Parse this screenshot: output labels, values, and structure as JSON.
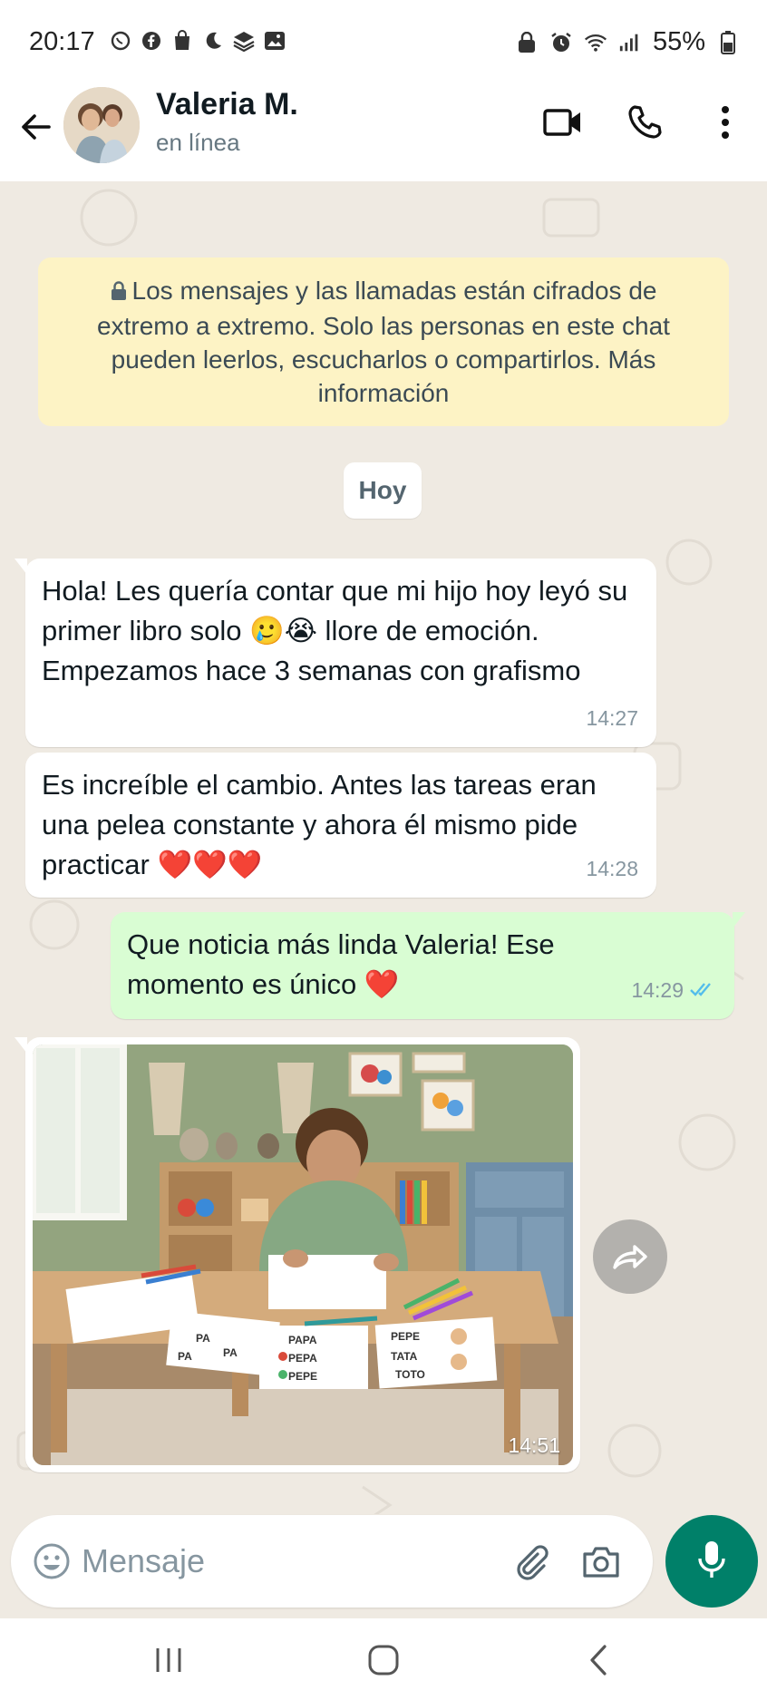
{
  "status_bar": {
    "time": "20:17",
    "battery": "55%"
  },
  "header": {
    "contact_name": "Valeria M.",
    "contact_status": "en línea"
  },
  "encryption_notice": "Los mensajes y las llamadas están cifrados de extremo a extremo. Solo las personas en este chat pueden leerlos, escucharlos o compartirlos. Más información",
  "date_chip": "Hoy",
  "messages": [
    {
      "direction": "in",
      "text": "Hola! Les quería contar que mi hijo hoy leyó su primer libro solo 🥲😭 llore de emoción.  Empezamos hace 3 semanas con grafismo",
      "time": "14:27"
    },
    {
      "direction": "in",
      "text": "Es increíble el cambio. Antes las tareas eran una pelea constante y ahora él mismo pide practicar ❤️❤️❤️",
      "time": "14:28"
    },
    {
      "direction": "out",
      "text": "Que noticia más linda Valeria! Ese momento es único ❤️",
      "time": "14:29",
      "read": true
    },
    {
      "direction": "in",
      "type": "image",
      "time": "14:51",
      "image_text": [
        "PA",
        "PA",
        "PA",
        "PAPA",
        "PEPA",
        "PEPE",
        "PEPE",
        "TATA",
        "TOTO"
      ]
    }
  ],
  "composer": {
    "placeholder": "Mensaje"
  },
  "colors": {
    "accent": "#008069",
    "outgoing_bubble": "#d9fdd3",
    "encryption_bg": "#fdf3c5",
    "read_ticks": "#53bdeb"
  }
}
